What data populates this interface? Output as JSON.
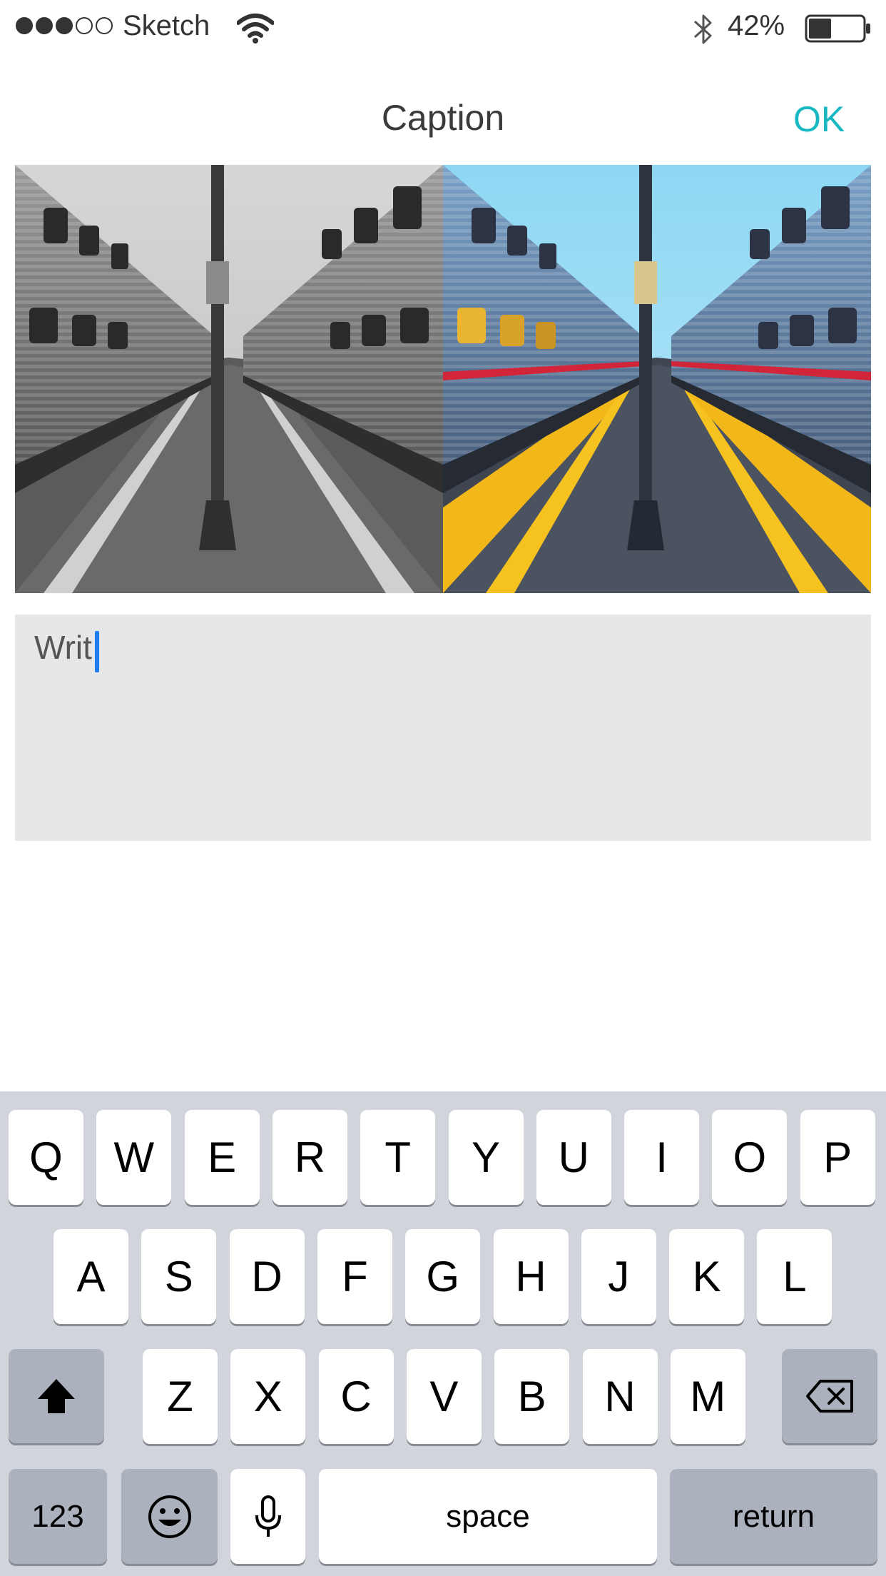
{
  "status": {
    "carrier": "Sketch",
    "battery_percent": "42%",
    "signal_bars_filled": 3,
    "signal_bars_total": 5,
    "battery_level": 0.42
  },
  "nav": {
    "title": "Caption",
    "ok_label": "OK"
  },
  "caption": {
    "value": "Writ"
  },
  "keyboard": {
    "row1": [
      "Q",
      "W",
      "E",
      "R",
      "T",
      "Y",
      "U",
      "I",
      "O",
      "P"
    ],
    "row2": [
      "A",
      "S",
      "D",
      "F",
      "G",
      "H",
      "J",
      "K",
      "L"
    ],
    "row3": [
      "Z",
      "X",
      "C",
      "V",
      "B",
      "N",
      "M"
    ],
    "numbers_label": "123",
    "space_label": "space",
    "return_label": "return"
  },
  "colors": {
    "accent": "#17b8c2",
    "cursor": "#1c7cf4",
    "keyboard_bg": "#d1d5db",
    "caption_bg": "#e7e7e7"
  }
}
